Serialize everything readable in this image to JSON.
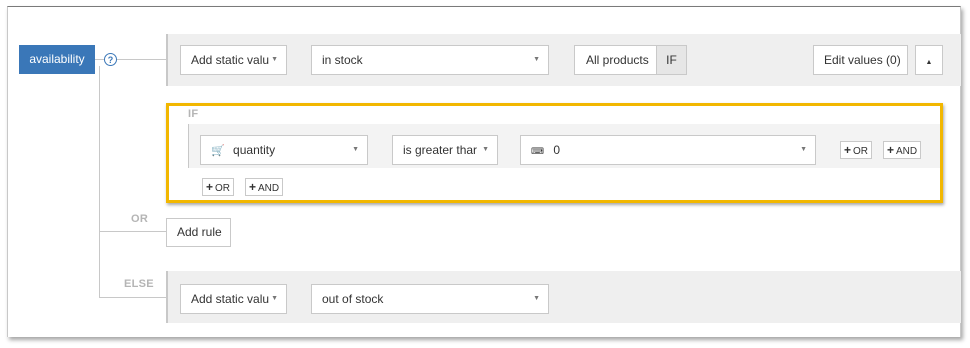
{
  "field": {
    "label": "availability",
    "help": "?"
  },
  "rule_row": {
    "source_label": "Add static valu",
    "value_text": "in stock",
    "products_label": "All products",
    "if_toggle": "IF",
    "edit_values_label": "Edit values (0)"
  },
  "condition_block": {
    "if_label": "IF",
    "attribute_label": "quantity",
    "operator_label": "is greater thar",
    "compare_value": "0",
    "or_label": "OR",
    "and_label": "AND",
    "footer_or_label": "OR",
    "footer_and_label": "AND"
  },
  "or_connector": "OR",
  "add_rule_label": "Add rule",
  "else_row": {
    "else_label": "ELSE",
    "source_label": "Add static valu",
    "value_text": "out of stock"
  },
  "colors": {
    "primary": "#3a77b8",
    "highlight_border": "#f2b700",
    "panel_bg": "#efefef"
  },
  "icons": [
    "help-icon",
    "dropdown-caret-icon",
    "collapse-caret-icon",
    "cart-icon",
    "keyboard-icon",
    "plus-icon"
  ]
}
